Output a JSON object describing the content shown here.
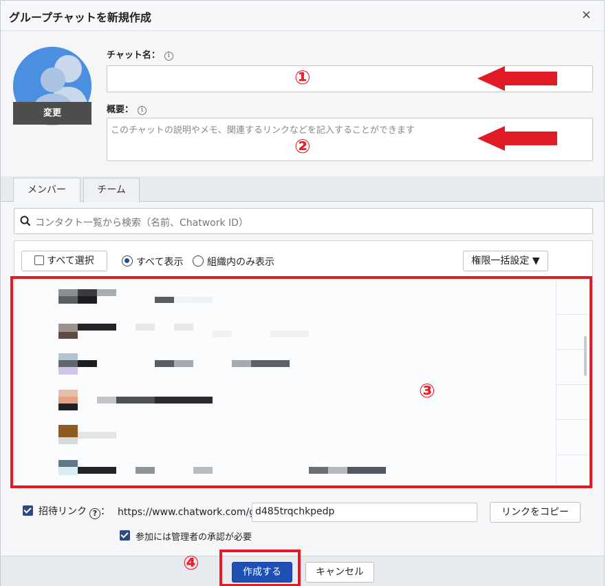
{
  "dialog": {
    "title": "グループチャットを新規作成",
    "close": "×"
  },
  "avatar": {
    "change_label": "変更"
  },
  "chat_name": {
    "label": "チャット名：",
    "info": "i",
    "value": ""
  },
  "summary": {
    "label": "概要：",
    "info": "i",
    "placeholder": "このチャットの説明やメモ、関連するリンクなどを記入することができます"
  },
  "annotations": {
    "n1": "①",
    "n2": "②",
    "n3": "③",
    "n4": "④",
    "accent": "#e11b26"
  },
  "tabs": [
    {
      "label": "メンバー",
      "active": true
    },
    {
      "label": "チーム",
      "active": false
    }
  ],
  "search": {
    "placeholder": "コンタクト一覧から検索（名前、Chatwork ID）"
  },
  "toolbar": {
    "select_all": "すべて選択",
    "show_all": "すべて表示",
    "show_org": "組織内のみ表示",
    "bulk_perm": "権限一括設定 ▼"
  },
  "invite": {
    "label": "招待リンク",
    "help": "?",
    "colon": "：",
    "url_prefix": "https://www.chatwork.com/g/",
    "url_code": "d485trqchkpedp",
    "copy_button": "リンクをコピー",
    "approval_label": "参加には管理者の承認が必要"
  },
  "footer": {
    "create": "作成する",
    "cancel": "キャンセル"
  },
  "colors": {
    "primary": "#1e4fb5",
    "checkbox": "#2c4a7c",
    "avatar_bg": "#4a8fe0"
  }
}
